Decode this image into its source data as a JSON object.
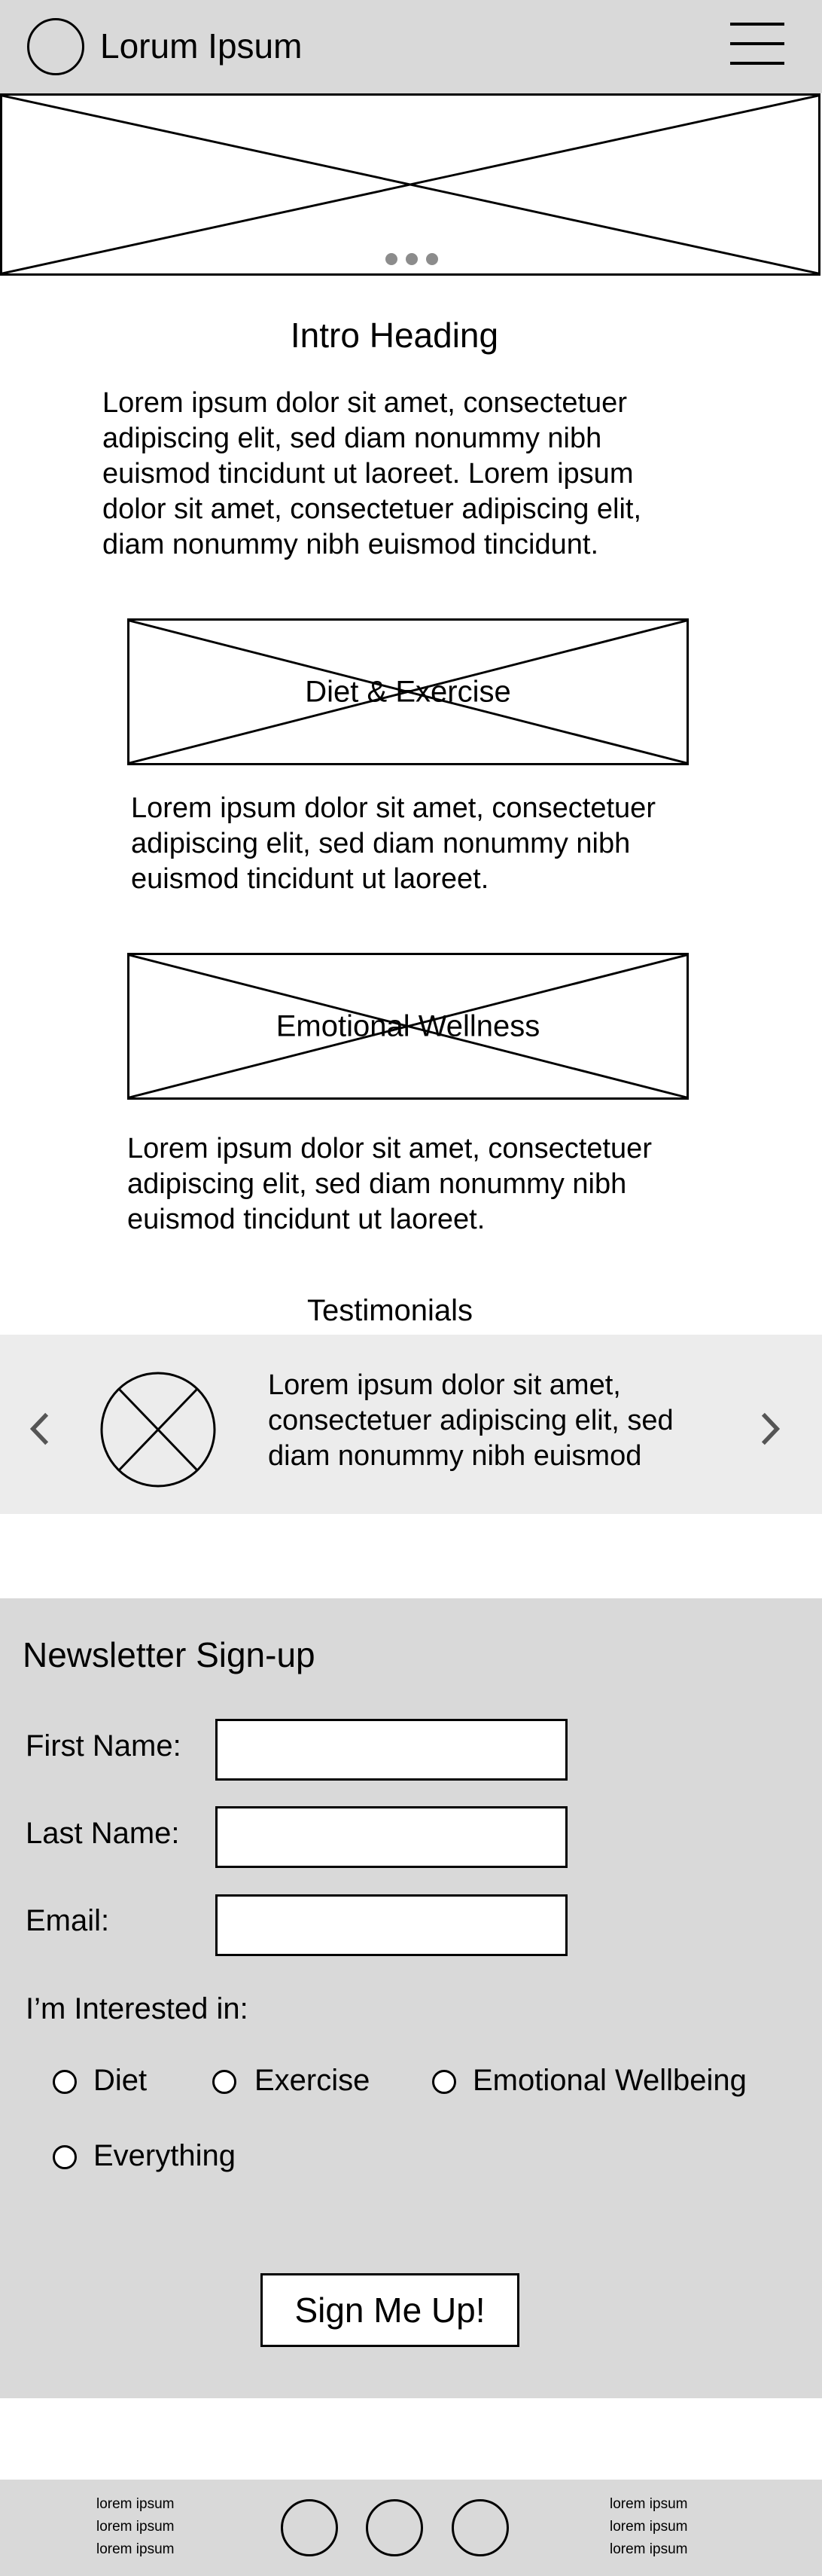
{
  "header": {
    "title": "Lorum Ipsum",
    "logo_icon": "circle-logo-icon",
    "menu_icon": "hamburger-menu-icon"
  },
  "hero": {
    "image_icon": "image-placeholder-icon",
    "pager_dots": 3
  },
  "intro": {
    "heading": "Intro Heading",
    "lines": [
      "Lorem ipsum dolor sit amet, consectetuer",
      "adipiscing elit, sed diam nonummy nibh",
      "euismod tincidunt ut laoreet. Lorem ipsum",
      "dolor sit amet, consectetuer adipiscing elit,",
      "diam nonummy nibh euismod tincidunt."
    ]
  },
  "sections": [
    {
      "caption": "Diet & Exercise",
      "lines": [
        "Lorem ipsum dolor sit amet, consectetuer",
        "adipiscing elit, sed diam nonummy nibh",
        "euismod tincidunt ut laoreet."
      ]
    },
    {
      "caption": "Emotional Wellness",
      "lines": [
        "Lorem ipsum dolor sit amet, consectetuer",
        "adipiscing elit, sed diam nonummy nibh",
        "euismod tincidunt ut laoreet."
      ]
    }
  ],
  "testimonials": {
    "heading": "Testimonials",
    "lines": [
      "Lorem ipsum dolor sit amet,",
      "consectetuer adipiscing elit, sed",
      "diam nonummy nibh euismod"
    ],
    "prev_icon": "chevron-left-icon",
    "next_icon": "chevron-right-icon",
    "avatar_icon": "avatar-placeholder-icon"
  },
  "newsletter": {
    "heading": "Newsletter Sign-up",
    "first_name_label": "First Name:",
    "last_name_label": "Last Name:",
    "email_label": "Email:",
    "first_name_value": "",
    "last_name_value": "",
    "email_value": "",
    "interest_label": "I’m Interested in:",
    "options": [
      "Diet",
      "Exercise",
      "Emotional Wellbeing",
      "Everything"
    ],
    "submit_label": "Sign Me Up!"
  },
  "footer": {
    "left_links": [
      "lorem ipsum",
      "lorem ipsum",
      "lorem ipsum"
    ],
    "right_links": [
      "lorem ipsum",
      "lorem ipsum",
      "lorem ipsum"
    ],
    "social_icons": [
      "social-circle-icon",
      "social-circle-icon",
      "social-circle-icon"
    ]
  },
  "colors": {
    "header_bg": "#d9d9d9",
    "testimonial_bg": "#ececec",
    "newsletter_bg": "#d9d9d9",
    "chevron": "#555555",
    "pager_dot": "#8c8c8c"
  }
}
